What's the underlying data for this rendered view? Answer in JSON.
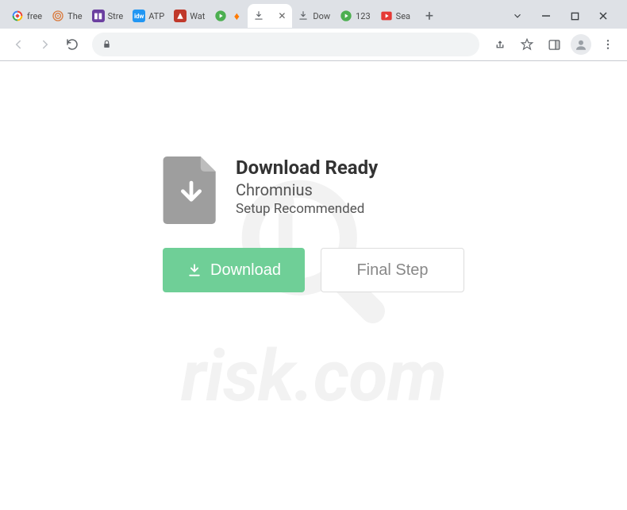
{
  "tabs": [
    {
      "title": "free",
      "favicon": "google"
    },
    {
      "title": "The",
      "favicon": "spiral"
    },
    {
      "title": "Stre",
      "favicon": "purple"
    },
    {
      "title": "ATP",
      "favicon": "blue"
    },
    {
      "title": "Wat",
      "favicon": "red"
    },
    {
      "title": "",
      "favicon": "greenplay"
    },
    {
      "title": "",
      "favicon": "download",
      "active": true
    },
    {
      "title": "Dow",
      "favicon": "download"
    },
    {
      "title": "123",
      "favicon": "greenplay"
    },
    {
      "title": "Sea",
      "favicon": "redplay"
    }
  ],
  "page": {
    "title": "Download Ready",
    "subtitle": "Chromnius",
    "recommended": "Setup Recommended",
    "download_button": "Download",
    "final_button": "Final Step"
  },
  "watermark": {
    "text": "risk.com"
  }
}
